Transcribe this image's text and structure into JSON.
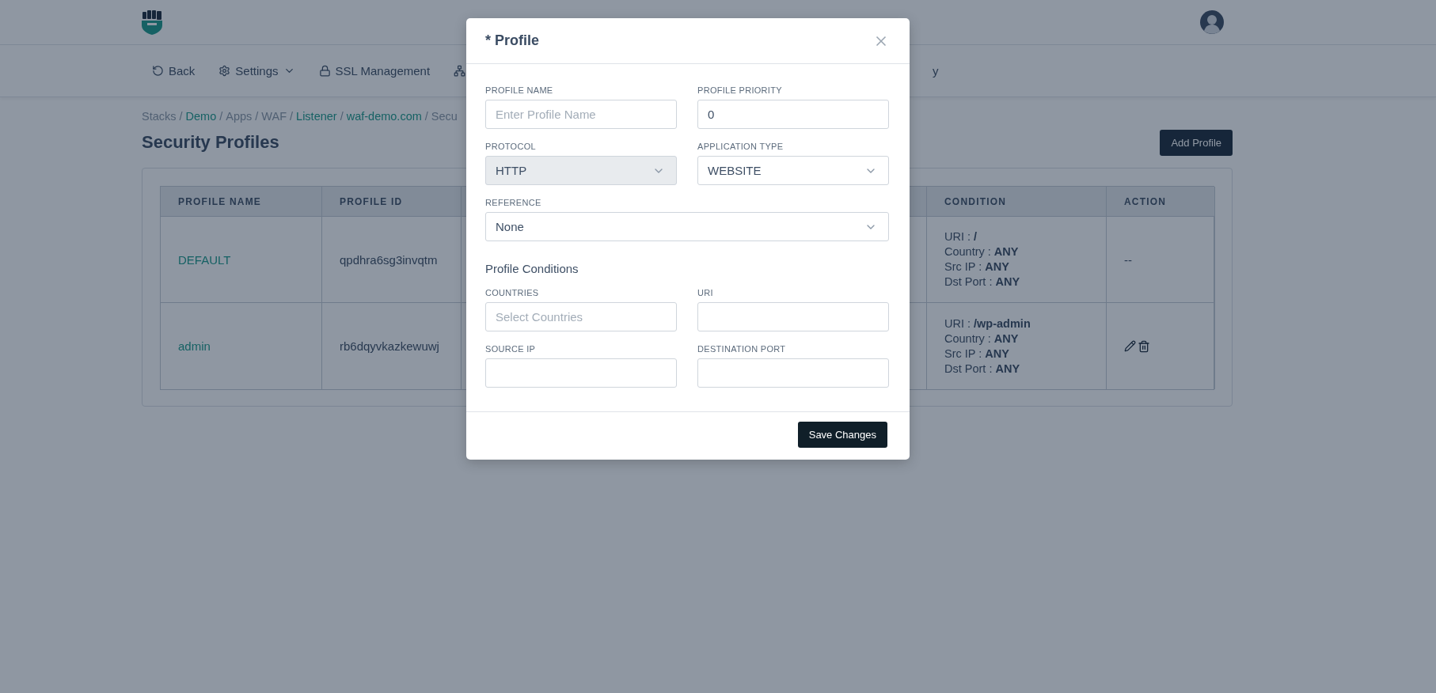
{
  "nav": {
    "items": [
      {
        "kind": "back",
        "label": "Back"
      },
      {
        "kind": "settings",
        "label": "Settings",
        "dropdown": true
      },
      {
        "kind": "lock",
        "label": "SSL Management"
      },
      {
        "kind": "network"
      },
      {
        "kind": "text",
        "label": "y"
      }
    ]
  },
  "breadcrumb": [
    {
      "kind": "crumb",
      "label": "Stacks",
      "link": false
    },
    {
      "kind": "separator",
      "label": "/"
    },
    {
      "kind": "crumb",
      "label": "Demo",
      "link": true
    },
    {
      "kind": "separator",
      "label": "/"
    },
    {
      "kind": "crumb",
      "label": "Apps",
      "link": false
    },
    {
      "kind": "separator",
      "label": "/"
    },
    {
      "kind": "crumb",
      "label": "WAF",
      "link": false
    },
    {
      "kind": "separator",
      "label": "/"
    },
    {
      "kind": "crumb",
      "label": "Listener",
      "link": true
    },
    {
      "kind": "separator",
      "label": "/"
    },
    {
      "kind": "crumb",
      "label": "waf-demo.com",
      "link": true
    },
    {
      "kind": "separator",
      "label": "/"
    },
    {
      "kind": "crumb",
      "label": "Secu",
      "link": false
    }
  ],
  "page_title": "Security Profiles",
  "add_button": "Add Profile",
  "table": {
    "columns": [
      "PROFILE NAME",
      "PROFILE ID",
      "CONDITION",
      "ACTION"
    ],
    "rows": [
      {
        "name": "DEFAULT",
        "id": "qpdhra6sg3invqtm",
        "condition": [
          "URI : **/**",
          "Country : **ANY**",
          "Src IP : **ANY**",
          "Dst Port : **ANY**"
        ],
        "action": {
          "kind": "none",
          "label": "--"
        }
      },
      {
        "name": "admin",
        "id": "rb6dqyvkazkewuwj",
        "condition": [
          "URI : **/wp-admin**",
          "Country : **ANY**",
          "Src IP : **ANY**",
          "Dst Port : **ANY**"
        ],
        "action": {
          "kind": "edit"
        }
      }
    ]
  },
  "modal": {
    "title": "* Profile",
    "fields": [
      {
        "label": "PROFILE NAME",
        "kind": "input",
        "placeholder": "Enter Profile Name"
      },
      {
        "label": "PROFILE PRIORITY",
        "kind": "input",
        "value": "0"
      },
      {
        "label": "PROTOCOL",
        "kind": "select",
        "value": "HTTP",
        "disabled": true
      },
      {
        "label": "APPLICATION TYPE",
        "kind": "select",
        "value": "WEBSITE",
        "disabled": false
      },
      {
        "label": "REFERENCE",
        "kind": "select",
        "value": "None",
        "disabled": false,
        "wide": true
      }
    ],
    "section_title": "Profile Conditions",
    "condition_fields": [
      {
        "label": "COUNTRIES",
        "kind": "input",
        "placeholder": "Select Countries"
      },
      {
        "label": "URI",
        "kind": "input"
      },
      {
        "label": "SOURCE IP",
        "kind": "input"
      },
      {
        "label": "DESTINATION PORT",
        "kind": "input"
      }
    ],
    "save_button": "Save Changes"
  }
}
